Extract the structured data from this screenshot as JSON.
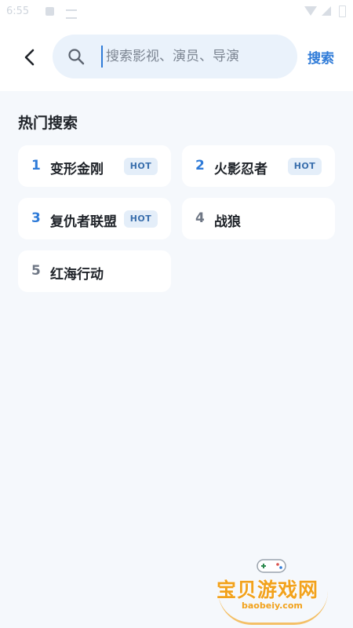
{
  "status_bar": {
    "time": "6:55"
  },
  "header": {
    "back_icon": "chevron-left-icon",
    "search": {
      "placeholder": "搜索影视、演员、导演",
      "value": "",
      "search_icon": "magnifier-icon"
    },
    "search_button_label": "搜索"
  },
  "hot": {
    "title": "热门搜索",
    "items": [
      {
        "rank": "1",
        "name": "变形金刚",
        "badge": "HOT"
      },
      {
        "rank": "2",
        "name": "火影忍者",
        "badge": "HOT"
      },
      {
        "rank": "3",
        "name": "复仇者联盟",
        "badge": "HOT"
      },
      {
        "rank": "4",
        "name": "战狼",
        "badge": ""
      },
      {
        "rank": "5",
        "name": "红海行动",
        "badge": ""
      }
    ]
  },
  "watermark": {
    "title": "宝贝游戏网",
    "url": "baobeiy.com"
  },
  "colors": {
    "accent": "#2f7bd8",
    "background": "#f5f8fc",
    "badge_bg": "#e4eef9",
    "watermark": "#f2a21c"
  }
}
